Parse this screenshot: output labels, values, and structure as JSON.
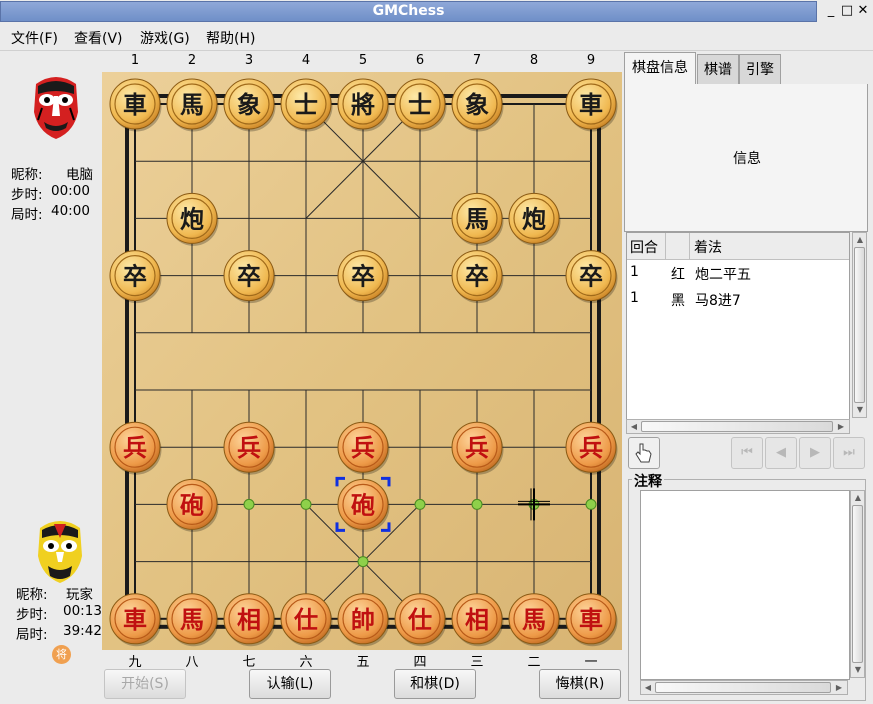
{
  "window": {
    "title": "GMChess",
    "minimize": "_",
    "maximize": "□",
    "close": "✕"
  },
  "menu": [
    "文件(F)",
    "查看(V)",
    "游戏(G)",
    "帮助(H)"
  ],
  "players": {
    "top": {
      "nick_label": "昵称:",
      "nick": "电脑",
      "step_label": "步时:",
      "step_time": "00:00",
      "game_label": "局时:",
      "game_time": "40:00"
    },
    "bottom": {
      "nick_label": "昵称:",
      "nick": "玩家",
      "step_label": "步时:",
      "step_time": "00:13",
      "game_label": "局时:",
      "game_time": "39:42",
      "side_badge": "将"
    }
  },
  "board": {
    "top_coords": [
      "1",
      "2",
      "3",
      "4",
      "5",
      "6",
      "7",
      "8",
      "9"
    ],
    "bottom_coords": [
      "九",
      "八",
      "七",
      "六",
      "五",
      "四",
      "三",
      "二",
      "一"
    ],
    "black_pieces": [
      {
        "t": "車",
        "c": 0,
        "r": 0
      },
      {
        "t": "馬",
        "c": 1,
        "r": 0
      },
      {
        "t": "象",
        "c": 2,
        "r": 0
      },
      {
        "t": "士",
        "c": 3,
        "r": 0
      },
      {
        "t": "將",
        "c": 4,
        "r": 0
      },
      {
        "t": "士",
        "c": 5,
        "r": 0
      },
      {
        "t": "象",
        "c": 6,
        "r": 0
      },
      {
        "t": "車",
        "c": 8,
        "r": 0
      },
      {
        "t": "炮",
        "c": 1,
        "r": 2
      },
      {
        "t": "馬",
        "c": 6,
        "r": 2
      },
      {
        "t": "炮",
        "c": 7,
        "r": 2
      },
      {
        "t": "卒",
        "c": 0,
        "r": 3
      },
      {
        "t": "卒",
        "c": 2,
        "r": 3
      },
      {
        "t": "卒",
        "c": 4,
        "r": 3
      },
      {
        "t": "卒",
        "c": 6,
        "r": 3
      },
      {
        "t": "卒",
        "c": 8,
        "r": 3
      }
    ],
    "red_pieces": [
      {
        "t": "兵",
        "c": 0,
        "r": 6
      },
      {
        "t": "兵",
        "c": 2,
        "r": 6
      },
      {
        "t": "兵",
        "c": 4,
        "r": 6
      },
      {
        "t": "兵",
        "c": 6,
        "r": 6
      },
      {
        "t": "兵",
        "c": 8,
        "r": 6
      },
      {
        "t": "砲",
        "c": 1,
        "r": 7
      },
      {
        "t": "砲",
        "c": 4,
        "r": 7
      },
      {
        "t": "車",
        "c": 0,
        "r": 9
      },
      {
        "t": "馬",
        "c": 1,
        "r": 9
      },
      {
        "t": "相",
        "c": 2,
        "r": 9
      },
      {
        "t": "仕",
        "c": 3,
        "r": 9
      },
      {
        "t": "帥",
        "c": 4,
        "r": 9
      },
      {
        "t": "仕",
        "c": 5,
        "r": 9
      },
      {
        "t": "相",
        "c": 6,
        "r": 9
      },
      {
        "t": "馬",
        "c": 7,
        "r": 9
      },
      {
        "t": "車",
        "c": 8,
        "r": 9
      }
    ],
    "hint_dots": [
      {
        "c": 4,
        "r": 3
      },
      {
        "c": 2,
        "r": 7
      },
      {
        "c": 3,
        "r": 7
      },
      {
        "c": 5,
        "r": 7
      },
      {
        "c": 6,
        "r": 7
      },
      {
        "c": 7,
        "r": 7
      },
      {
        "c": 8,
        "r": 7
      },
      {
        "c": 4,
        "r": 8
      }
    ],
    "selected": {
      "c": 4,
      "r": 7
    },
    "cursor": {
      "c": 7,
      "r": 7
    },
    "colors": {
      "wood_light": "#e8c98a",
      "wood_dark": "#d8b070",
      "piece_black_text": "#1a1a1a",
      "piece_red_text": "#c01010",
      "hint": "#8ed04a",
      "select": "#1030e0"
    }
  },
  "buttons": {
    "start": "开始(S)",
    "resign": "认输(L)",
    "draw": "和棋(D)",
    "undo": "悔棋(R)"
  },
  "tabs": [
    "棋盘信息",
    "棋谱",
    "引擎"
  ],
  "info_label": "信息",
  "move_list": {
    "headers": [
      "回合",
      "",
      "着法"
    ],
    "rows": [
      {
        "round": "1",
        "side": "红",
        "move": "炮二平五"
      },
      {
        "round": "1",
        "side": "黑",
        "move": "马8进7"
      }
    ]
  },
  "comment_title": "注释"
}
